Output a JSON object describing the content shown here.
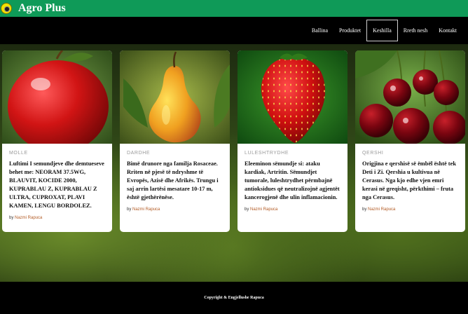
{
  "brand": {
    "name": "Agro Plus"
  },
  "nav": {
    "items": [
      {
        "label": "Ballina",
        "active": false
      },
      {
        "label": "Produktet",
        "active": false
      },
      {
        "label": "Keshilla",
        "active": true
      },
      {
        "label": "Rreth nesh",
        "active": false
      },
      {
        "label": "Kontakt",
        "active": false
      }
    ]
  },
  "cards": [
    {
      "category": "MOLLE",
      "text": "Luftimi I semundjeve dhe demtueseve behet me: NEORAM 37.5WG, BLAUVIT, KOCIDE 2000, KUPRABLAU Z, KUPRABLAU Z ULTRA, CUPROXAT, PLAVI KAMEN, LENGU BORDOLEZ.",
      "by": "by",
      "author": "Nazmi Rapuca",
      "image": "apple"
    },
    {
      "category": "DARDHE",
      "text": "Bimë drunore nga familja Rosaceae. Rriten në pjesë të ndryshme të Evropës, Azisë dhe Afrikës. Trungu i saj arrin lartësi mesatare 10-17 m, është gjethërënëse.",
      "by": "by",
      "author": "Nazmi Rapuca",
      "image": "pear"
    },
    {
      "category": "LULESHTRYDHE",
      "text": "Eleeminon sëmundje si: ataku kardiak, Artritin. Sëmundjet tumorale, luleshtrydhet përmbajnë antioksidues që neutralizojnë agjentët kancerogjenë dhe ulin inflamacionin.",
      "by": "by",
      "author": "Nazmi Rapuca",
      "image": "strawberry"
    },
    {
      "category": "QERSHI",
      "text": "Origjina e qershisë së ëmbël është tek Deti i Zi. Qershia u kultivua në Cerasus. Nga kjo edhe vjen emri kerasi në greqisht, përkthimi – fruta nga Cerasus.",
      "by": "by",
      "author": "Nazmi Rapuca",
      "image": "cherry"
    }
  ],
  "footer": {
    "text": "Copyright & Engjellushe Rapuca"
  },
  "colors": {
    "brand_green": "#0f9a58",
    "nav_bg": "#000000",
    "author": "#b25a23"
  }
}
